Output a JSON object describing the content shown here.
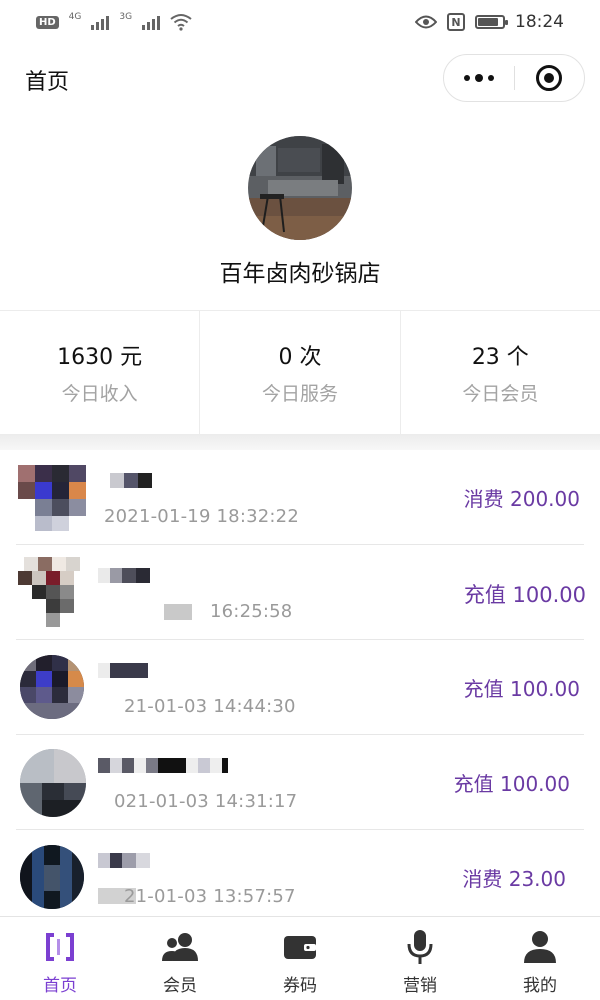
{
  "status_bar": {
    "badge": "HD",
    "network_1": "4G",
    "network_2": "3G",
    "nfc": "N",
    "battery_level": 0.85,
    "time": "18:24"
  },
  "nav": {
    "title": "首页"
  },
  "profile": {
    "store_name": "百年卤肉砂锅店"
  },
  "stats": [
    {
      "value": "1630 元",
      "label": "今日收入"
    },
    {
      "value": "0 次",
      "label": "今日服务"
    },
    {
      "value": "23 个",
      "label": "今日会员"
    }
  ],
  "records": [
    {
      "time": "2021-01-19 18:32:22",
      "amount": "消费 200.00"
    },
    {
      "time": "16:25:58",
      "amount": "充值 100.00"
    },
    {
      "time": "21-01-03 14:44:30",
      "amount": "充值 100.00"
    },
    {
      "time": "021-01-03 14:31:17",
      "amount": "充值 100.00"
    },
    {
      "time": "21-01-03 13:57:57",
      "amount": "消费 23.00"
    }
  ],
  "tabs": [
    {
      "label": "首页",
      "icon": "home-bracket-icon",
      "active": true
    },
    {
      "label": "会员",
      "icon": "members-icon",
      "active": false
    },
    {
      "label": "券码",
      "icon": "wallet-icon",
      "active": false
    },
    {
      "label": "营销",
      "icon": "microphone-icon",
      "active": false
    },
    {
      "label": "我的",
      "icon": "person-icon",
      "active": false
    }
  ],
  "colors": {
    "accent": "#7b3fd1",
    "amount": "#6a3aa3",
    "muted": "#a3a3a3"
  }
}
